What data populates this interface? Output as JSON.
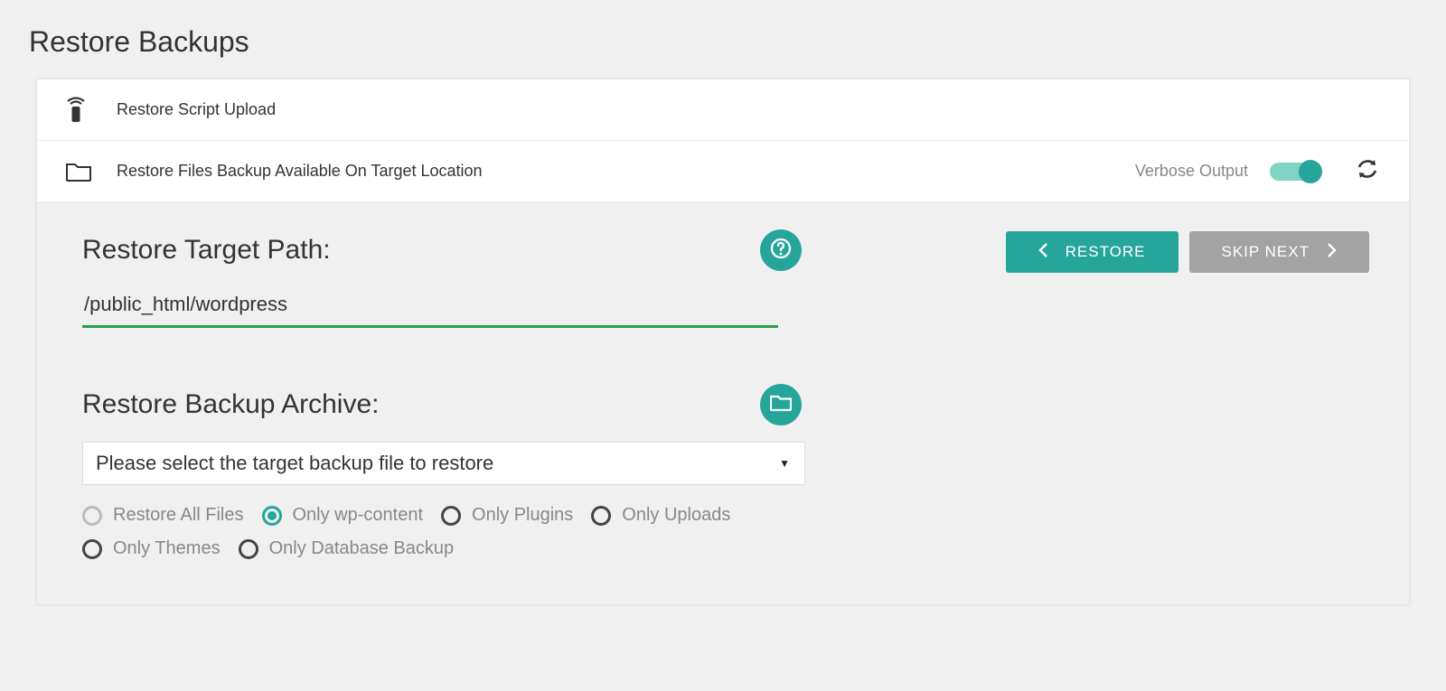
{
  "page": {
    "title": "Restore Backups"
  },
  "rows": {
    "upload": {
      "label": "Restore Script Upload"
    },
    "files": {
      "label": "Restore Files Backup Available On Target Location"
    }
  },
  "verbose": {
    "label": "Verbose Output",
    "on": true
  },
  "target_path": {
    "title": "Restore Target Path:",
    "value": "/public_html/wordpress"
  },
  "archive": {
    "title": "Restore Backup Archive:",
    "placeholder": "Please select the target backup file to restore"
  },
  "radios": {
    "all": {
      "label": "Restore All Files"
    },
    "wpcontent": {
      "label": "Only wp-content"
    },
    "plugins": {
      "label": "Only Plugins"
    },
    "uploads": {
      "label": "Only Uploads"
    },
    "themes": {
      "label": "Only Themes"
    },
    "db": {
      "label": "Only Database Backup"
    },
    "selected": "wpcontent"
  },
  "buttons": {
    "restore": {
      "label": "RESTORE"
    },
    "skipnext": {
      "label": "SKIP NEXT"
    }
  },
  "colors": {
    "teal": "#26a69a",
    "green_underline": "#26a145",
    "grey_btn": "#a3a3a3"
  }
}
